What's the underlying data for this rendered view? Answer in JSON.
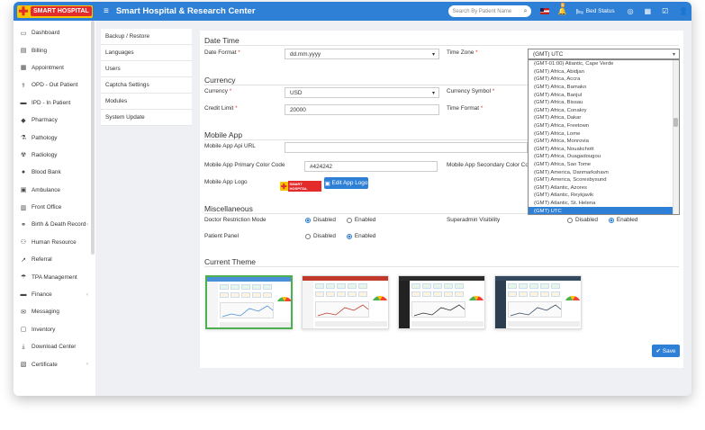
{
  "header": {
    "logo_text": "SMART HOSPITAL",
    "title": "Smart Hospital & Research Center",
    "search_placeholder": "Search By Patient Name",
    "notification_badge": "5",
    "bed_status": "Bed Status"
  },
  "sidebar": {
    "items": [
      {
        "label": "Dashboard",
        "icon": "monitor-icon"
      },
      {
        "label": "Billing",
        "icon": "file-icon"
      },
      {
        "label": "Appointment",
        "icon": "calendar-icon"
      },
      {
        "label": "OPD - Out Patient",
        "icon": "stethoscope-icon"
      },
      {
        "label": "IPD - In Patient",
        "icon": "bed-icon"
      },
      {
        "label": "Pharmacy",
        "icon": "pill-icon"
      },
      {
        "label": "Pathology",
        "icon": "flask-icon"
      },
      {
        "label": "Radiology",
        "icon": "radiation-icon"
      },
      {
        "label": "Blood Bank",
        "icon": "drop-icon"
      },
      {
        "label": "Ambulance",
        "icon": "ambulance-icon"
      },
      {
        "label": "Front Office",
        "icon": "desk-icon"
      },
      {
        "label": "Birth & Death Record",
        "icon": "family-icon"
      },
      {
        "label": "Human Resource",
        "icon": "people-icon"
      },
      {
        "label": "Referral",
        "icon": "share-icon"
      },
      {
        "label": "TPA Management",
        "icon": "umbrella-icon"
      },
      {
        "label": "Finance",
        "icon": "money-icon"
      },
      {
        "label": "Messaging",
        "icon": "chat-icon"
      },
      {
        "label": "Inventory",
        "icon": "box-icon"
      },
      {
        "label": "Download Center",
        "icon": "download-icon"
      },
      {
        "label": "Certificate",
        "icon": "certificate-icon"
      }
    ]
  },
  "submenu": {
    "items": [
      "Backup / Restore",
      "Languages",
      "Users",
      "Captcha Settings",
      "Modules",
      "System Update"
    ]
  },
  "datetime": {
    "title": "Date Time",
    "date_format_label": "Date Format",
    "date_format_value": "dd.mm.yyyy",
    "time_zone_label": "Time Zone",
    "time_zone_value": "(GMT) UTC"
  },
  "currency": {
    "title": "Currency",
    "currency_label": "Currency",
    "currency_value": "USD",
    "symbol_label": "Currency Symbol",
    "credit_limit_label": "Credit Limit",
    "credit_limit_value": "20000",
    "time_format_label": "Time Format"
  },
  "mobile_app": {
    "title": "Mobile App",
    "api_url_label": "Mobile App Api URL",
    "primary_color_label": "Mobile App Primary Color Code",
    "primary_color_value": "#424242",
    "secondary_color_label": "Mobile App Secondary Color Code",
    "logo_label": "Mobile App Logo",
    "logo_text": "SMART HOSPITAL",
    "edit_logo_button": "Edit App Logo"
  },
  "misc": {
    "title": "Miscellaneous",
    "doctor_restriction_label": "Doctor Restriction Mode",
    "superadmin_label": "Superadmin Visibility",
    "patient_panel_label": "Patient Panel",
    "disabled": "Disabled",
    "enabled": "Enabled"
  },
  "theme": {
    "title": "Current Theme",
    "colors": [
      "#4a90d9",
      "#c0392b",
      "#2c2c2c",
      "#34495e"
    ]
  },
  "timezone_options": [
    "(GMT-01:00) Atlantic, Cape Verde",
    "(GMT) Africa, Abidjan",
    "(GMT) Africa, Accra",
    "(GMT) Africa, Bamako",
    "(GMT) Africa, Banjul",
    "(GMT) Africa, Bissau",
    "(GMT) Africa, Conakry",
    "(GMT) Africa, Dakar",
    "(GMT) Africa, Freetown",
    "(GMT) Africa, Lome",
    "(GMT) Africa, Monrovia",
    "(GMT) Africa, Nouakchott",
    "(GMT) Africa, Ouagadougou",
    "(GMT) Africa, Sao Tome",
    "(GMT) America, Danmarkshavn",
    "(GMT) America, Scoresbysund",
    "(GMT) Atlantic, Azores",
    "(GMT) Atlantic, Reykjavik",
    "(GMT) Atlantic, St. Helena",
    "(GMT) UTC"
  ],
  "save_button": "Save"
}
